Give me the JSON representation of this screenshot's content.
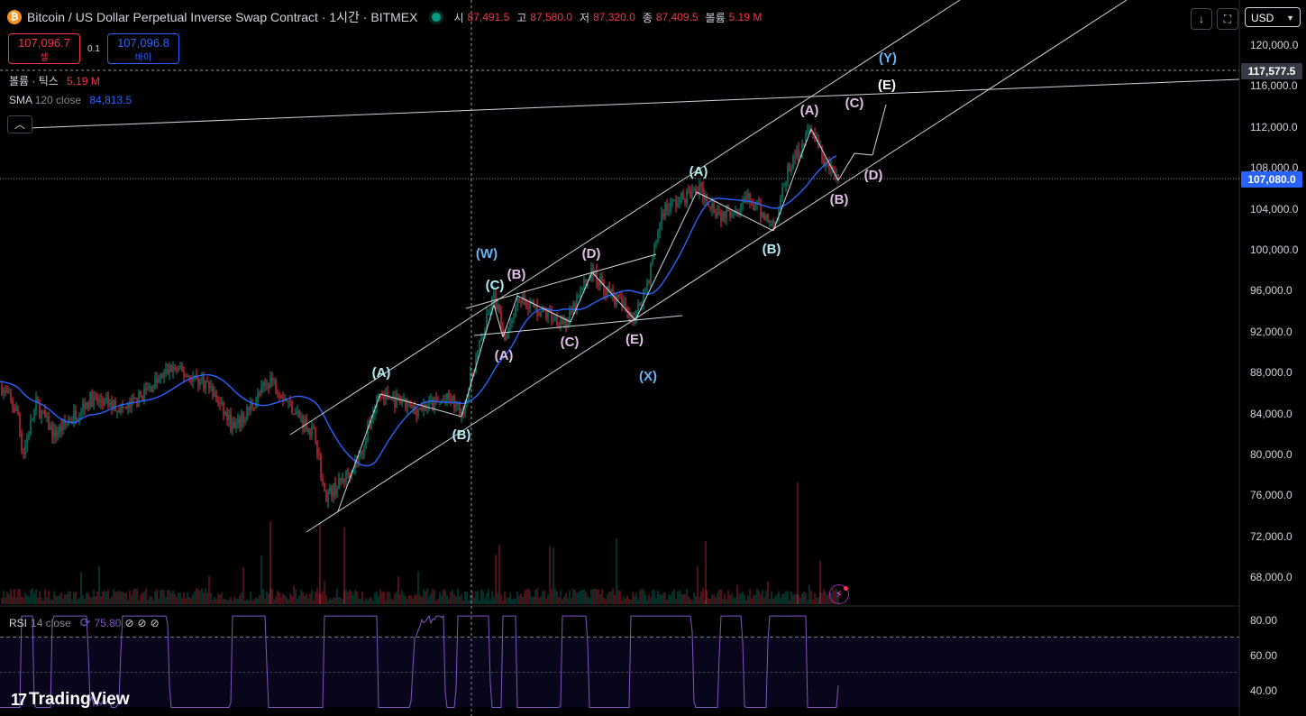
{
  "header": {
    "symbol_icon": "bitcoin-icon",
    "title": "Bitcoin / US Dollar Perpetual Inverse Swap Contract · 1시간 · BITMEX",
    "ohlc": [
      {
        "label": "시",
        "value": "87,491.5"
      },
      {
        "label": "고",
        "value": "87,580.0"
      },
      {
        "label": "저",
        "value": "87,320.0"
      },
      {
        "label": "종",
        "value": "87,409.5"
      },
      {
        "label": "볼륨",
        "value": "5.19 M"
      }
    ]
  },
  "trade": {
    "sell_price": "107,096.7",
    "sell_label": "셀",
    "spread": "0.1",
    "buy_price": "107,096.8",
    "buy_label": "바이"
  },
  "legends": {
    "volume_label": "볼륨 · 틱스",
    "volume_value": "5.19 M",
    "sma_name": "SMA",
    "sma_params": "120 close",
    "sma_value": "84,813.5",
    "collapse_icon": "chevron-up-icon"
  },
  "toolbar": {
    "download_icon": "arrow-down-icon",
    "fullscreen_icon": "fullscreen-icon",
    "currency": "USD"
  },
  "price_axis": {
    "labels": [
      "120,000.0",
      "116,000.0",
      "112,000.0",
      "108,000.0",
      "104,000.0",
      "100,000.0",
      "96,000.0",
      "92,000.0",
      "88,000.0",
      "84,000.0",
      "80,000.0",
      "76,000.0",
      "72,000.0",
      "68,000.0"
    ],
    "tag_upper": "117,577.5",
    "tag_current": "107,080.0"
  },
  "waves": [
    {
      "text": "(W)",
      "color": "#64b5f6"
    },
    {
      "text": "(X)",
      "color": "#64b5f6"
    },
    {
      "text": "(Y)",
      "color": "#64b5f6"
    },
    {
      "text": "(A)",
      "color": "#b2ebf2"
    },
    {
      "text": "(B)",
      "color": "#b2ebf2"
    },
    {
      "text": "(C)",
      "color": "#b2ebf2"
    },
    {
      "text": "(A)",
      "color": "#b2ebf2"
    },
    {
      "text": "(B)",
      "color": "#b2ebf2"
    },
    {
      "text": "(A)",
      "color": "#e1bee7"
    },
    {
      "text": "(B)",
      "color": "#e1bee7"
    },
    {
      "text": "(C)",
      "color": "#e1bee7"
    },
    {
      "text": "(D)",
      "color": "#e1bee7"
    },
    {
      "text": "(E)",
      "color": "#e1bee7"
    },
    {
      "text": "(A)",
      "color": "#e1bee7"
    },
    {
      "text": "(B)",
      "color": "#e1bee7"
    },
    {
      "text": "(C)",
      "color": "#e1bee7"
    },
    {
      "text": "(D)",
      "color": "#e1bee7"
    },
    {
      "text": "(E)",
      "color": "#ffffff"
    }
  ],
  "rsi": {
    "name": "RSI",
    "params": "14 close",
    "value": "75.80",
    "icons": [
      "refresh-icon",
      "hidden-icon",
      "hidden-icon",
      "hidden-icon"
    ],
    "axis": [
      "80.00",
      "60.00",
      "40.00"
    ],
    "upper_band": 70,
    "lower_band": 30
  },
  "branding": {
    "logo_text": "TradingView",
    "logo_icon": "tradingview-logo"
  },
  "colors": {
    "up": "#089981",
    "down": "#f23645",
    "sma": "#2962ff",
    "rsi": "#7e57c2",
    "rsi_band": "#311b92",
    "trend_lines": "#d1d4dc"
  }
}
